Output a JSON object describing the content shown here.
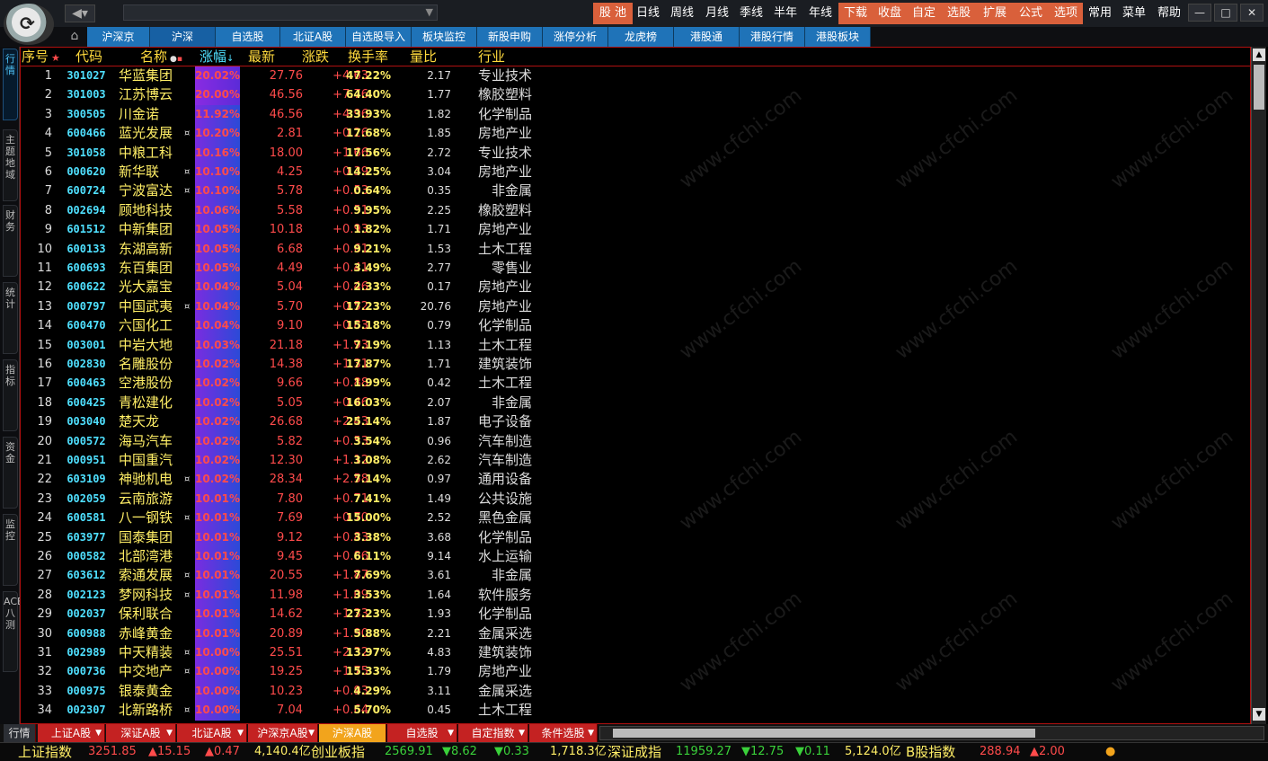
{
  "topbar": {
    "menus_orange": [
      "股 池",
      "下载",
      "收盘",
      "自定",
      "选股",
      "扩展",
      "公式",
      "选项"
    ],
    "menus_plain": [
      "日线",
      "周线",
      "月线",
      "季线",
      "半年",
      "年线",
      "常用",
      "菜单",
      "帮助"
    ],
    "win": [
      "—",
      "□",
      "✕"
    ]
  },
  "tabs": [
    "沪深京",
    "沪深",
    "自选股",
    "北证A股",
    "自选股导入",
    "板块监控",
    "新股申购",
    "涨停分析",
    "龙虎榜",
    "港股通",
    "港股行情",
    "港股板块"
  ],
  "sidebar": [
    "行情",
    "主题地域",
    "财务",
    "统计",
    "指标",
    "资金",
    "监控",
    "ACE八测"
  ],
  "headers": {
    "seq": "序号",
    "code": "代码",
    "name": "名称",
    "pct": "涨幅",
    "last": "最新",
    "chg": "涨跌",
    "turn": "换手率",
    "vr": "量比",
    "ind": "行业"
  },
  "rows": [
    {
      "seq": "1",
      "code": "301027",
      "name": "华蓝集团",
      "mark": "",
      "pct": "20.02%",
      "last": "27.76",
      "chg": "+4.63",
      "turn": "47.22%",
      "vr": "2.17",
      "ind": "专业技术"
    },
    {
      "seq": "2",
      "code": "301003",
      "name": "江苏博云",
      "mark": "",
      "pct": "20.00%",
      "last": "46.56",
      "chg": "+7.76",
      "turn": "64.40%",
      "vr": "1.77",
      "ind": "橡胶塑料"
    },
    {
      "seq": "3",
      "code": "300505",
      "name": "川金诺",
      "mark": "",
      "pct": "11.92%",
      "last": "46.56",
      "chg": "+4.96",
      "turn": "33.93%",
      "vr": "1.82",
      "ind": "化学制品"
    },
    {
      "seq": "4",
      "code": "600466",
      "name": "蓝光发展",
      "mark": "¤",
      "pct": "10.20%",
      "last": "2.81",
      "chg": "+0.26",
      "turn": "17.68%",
      "vr": "1.85",
      "ind": "房地产业"
    },
    {
      "seq": "5",
      "code": "301058",
      "name": "中粮工科",
      "mark": "",
      "pct": "10.16%",
      "last": "18.00",
      "chg": "+1.66",
      "turn": "17.56%",
      "vr": "2.72",
      "ind": "专业技术"
    },
    {
      "seq": "6",
      "code": "000620",
      "name": "新华联",
      "mark": "¤",
      "pct": "10.10%",
      "last": "4.25",
      "chg": "+0.39",
      "turn": "14.25%",
      "vr": "3.04",
      "ind": "房地产业"
    },
    {
      "seq": "7",
      "code": "600724",
      "name": "宁波富达",
      "mark": "¤",
      "pct": "10.10%",
      "last": "5.78",
      "chg": "+0.53",
      "turn": "0.64%",
      "vr": "0.35",
      "ind": "非金属"
    },
    {
      "seq": "8",
      "code": "002694",
      "name": "顾地科技",
      "mark": "",
      "pct": "10.06%",
      "last": "5.58",
      "chg": "+0.51",
      "turn": "9.95%",
      "vr": "2.25",
      "ind": "橡胶塑料"
    },
    {
      "seq": "9",
      "code": "601512",
      "name": "中新集团",
      "mark": "",
      "pct": "10.05%",
      "last": "10.18",
      "chg": "+0.93",
      "turn": "1.82%",
      "vr": "1.71",
      "ind": "房地产业"
    },
    {
      "seq": "10",
      "code": "600133",
      "name": "东湖高新",
      "mark": "",
      "pct": "10.05%",
      "last": "6.68",
      "chg": "+0.61",
      "turn": "9.21%",
      "vr": "1.53",
      "ind": "土木工程"
    },
    {
      "seq": "11",
      "code": "600693",
      "name": "东百集团",
      "mark": "",
      "pct": "10.05%",
      "last": "4.49",
      "chg": "+0.41",
      "turn": "3.49%",
      "vr": "2.77",
      "ind": "零售业"
    },
    {
      "seq": "12",
      "code": "600622",
      "name": "光大嘉宝",
      "mark": "",
      "pct": "10.04%",
      "last": "5.04",
      "chg": "+0.46",
      "turn": "2.33%",
      "vr": "0.17",
      "ind": "房地产业"
    },
    {
      "seq": "13",
      "code": "000797",
      "name": "中国武夷",
      "mark": "¤",
      "pct": "10.04%",
      "last": "5.70",
      "chg": "+0.52",
      "turn": "17.23%",
      "vr": "20.76",
      "ind": "房地产业"
    },
    {
      "seq": "14",
      "code": "600470",
      "name": "六国化工",
      "mark": "",
      "pct": "10.04%",
      "last": "9.10",
      "chg": "+0.83",
      "turn": "15.18%",
      "vr": "0.79",
      "ind": "化学制品"
    },
    {
      "seq": "15",
      "code": "003001",
      "name": "中岩大地",
      "mark": "",
      "pct": "10.03%",
      "last": "21.18",
      "chg": "+1.93",
      "turn": "7.19%",
      "vr": "1.13",
      "ind": "土木工程"
    },
    {
      "seq": "16",
      "code": "002830",
      "name": "名雕股份",
      "mark": "",
      "pct": "10.02%",
      "last": "14.38",
      "chg": "+1.31",
      "turn": "17.87%",
      "vr": "1.71",
      "ind": "建筑装饰"
    },
    {
      "seq": "17",
      "code": "600463",
      "name": "空港股份",
      "mark": "",
      "pct": "10.02%",
      "last": "9.66",
      "chg": "+0.88",
      "turn": "1.99%",
      "vr": "0.42",
      "ind": "土木工程"
    },
    {
      "seq": "18",
      "code": "600425",
      "name": "青松建化",
      "mark": "",
      "pct": "10.02%",
      "last": "5.05",
      "chg": "+0.46",
      "turn": "16.03%",
      "vr": "2.07",
      "ind": "非金属"
    },
    {
      "seq": "19",
      "code": "003040",
      "name": "楚天龙",
      "mark": "",
      "pct": "10.02%",
      "last": "26.68",
      "chg": "+2.43",
      "turn": "25.14%",
      "vr": "1.87",
      "ind": "电子设备"
    },
    {
      "seq": "20",
      "code": "000572",
      "name": "海马汽车",
      "mark": "",
      "pct": "10.02%",
      "last": "5.82",
      "chg": "+0.53",
      "turn": "3.54%",
      "vr": "0.96",
      "ind": "汽车制造"
    },
    {
      "seq": "21",
      "code": "000951",
      "name": "中国重汽",
      "mark": "",
      "pct": "10.02%",
      "last": "12.30",
      "chg": "+1.12",
      "turn": "3.08%",
      "vr": "2.62",
      "ind": "汽车制造"
    },
    {
      "seq": "22",
      "code": "603109",
      "name": "神驰机电",
      "mark": "¤",
      "pct": "10.02%",
      "last": "28.34",
      "chg": "+2.58",
      "turn": "7.14%",
      "vr": "0.97",
      "ind": "通用设备"
    },
    {
      "seq": "23",
      "code": "002059",
      "name": "云南旅游",
      "mark": "",
      "pct": "10.01%",
      "last": "7.80",
      "chg": "+0.71",
      "turn": "7.41%",
      "vr": "1.49",
      "ind": "公共设施"
    },
    {
      "seq": "24",
      "code": "600581",
      "name": "八一钢铁",
      "mark": "¤",
      "pct": "10.01%",
      "last": "7.69",
      "chg": "+0.70",
      "turn": "15.00%",
      "vr": "2.52",
      "ind": "黑色金属"
    },
    {
      "seq": "25",
      "code": "603977",
      "name": "国泰集团",
      "mark": "",
      "pct": "10.01%",
      "last": "9.12",
      "chg": "+0.83",
      "turn": "3.38%",
      "vr": "3.68",
      "ind": "化学制品"
    },
    {
      "seq": "26",
      "code": "000582",
      "name": "北部湾港",
      "mark": "",
      "pct": "10.01%",
      "last": "9.45",
      "chg": "+0.86",
      "turn": "6.11%",
      "vr": "9.14",
      "ind": "水上运输"
    },
    {
      "seq": "27",
      "code": "603612",
      "name": "索通发展",
      "mark": "¤",
      "pct": "10.01%",
      "last": "20.55",
      "chg": "+1.87",
      "turn": "7.69%",
      "vr": "3.61",
      "ind": "非金属"
    },
    {
      "seq": "28",
      "code": "002123",
      "name": "梦网科技",
      "mark": "¤",
      "pct": "10.01%",
      "last": "11.98",
      "chg": "+1.09",
      "turn": "3.53%",
      "vr": "1.64",
      "ind": "软件服务"
    },
    {
      "seq": "29",
      "code": "002037",
      "name": "保利联合",
      "mark": "",
      "pct": "10.01%",
      "last": "14.62",
      "chg": "+1.33",
      "turn": "27.23%",
      "vr": "1.93",
      "ind": "化学制品"
    },
    {
      "seq": "30",
      "code": "600988",
      "name": "赤峰黄金",
      "mark": "",
      "pct": "10.01%",
      "last": "20.89",
      "chg": "+1.90",
      "turn": "5.88%",
      "vr": "2.21",
      "ind": "金属采选"
    },
    {
      "seq": "31",
      "code": "002989",
      "name": "中天精装",
      "mark": "¤",
      "pct": "10.00%",
      "last": "25.51",
      "chg": "+2.32",
      "turn": "13.97%",
      "vr": "4.83",
      "ind": "建筑装饰"
    },
    {
      "seq": "32",
      "code": "000736",
      "name": "中交地产",
      "mark": "¤",
      "pct": "10.00%",
      "last": "19.25",
      "chg": "+1.75",
      "turn": "15.33%",
      "vr": "1.79",
      "ind": "房地产业"
    },
    {
      "seq": "33",
      "code": "000975",
      "name": "银泰黄金",
      "mark": "",
      "pct": "10.00%",
      "last": "10.23",
      "chg": "+0.93",
      "turn": "4.29%",
      "vr": "3.11",
      "ind": "金属采选"
    },
    {
      "seq": "34",
      "code": "002307",
      "name": "北新路桥",
      "mark": "¤",
      "pct": "10.00%",
      "last": "7.04",
      "chg": "+0.64",
      "turn": "5.70%",
      "vr": "0.45",
      "ind": "土木工程"
    }
  ],
  "bottom_tabs": [
    "行情",
    "上证A股",
    "深证A股",
    "北证A股",
    "沪深京A股",
    "沪深A股",
    "自选股",
    "自定指数",
    "条件选股"
  ],
  "status": {
    "sh_name": "上证指数",
    "sh_val": "3251.85",
    "sh_chg": "▲15.15",
    "sh_pct": "▲0.47",
    "sh_amt": "4,140.4亿",
    "cy_name": "创业板指",
    "cy_val": "2569.91",
    "cy_chg": "▼8.62",
    "cy_pct": "▼0.33",
    "cy_amt": "1,718.3亿",
    "sz_name": "深证成指",
    "sz_val": "11959.27",
    "sz_chg": "▼12.75",
    "sz_pct": "▼0.11",
    "sz_amt": "5,124.0亿",
    "b_name": "B股指数",
    "b_val": "288.94",
    "b_chg": "▲2.00"
  },
  "colors": {
    "up": "#ff4b4b",
    "down": "#3ad13a",
    "accent_orange": "#d9603b",
    "tab_blue": "#1f73b8",
    "bottom_red": "#c42222"
  }
}
